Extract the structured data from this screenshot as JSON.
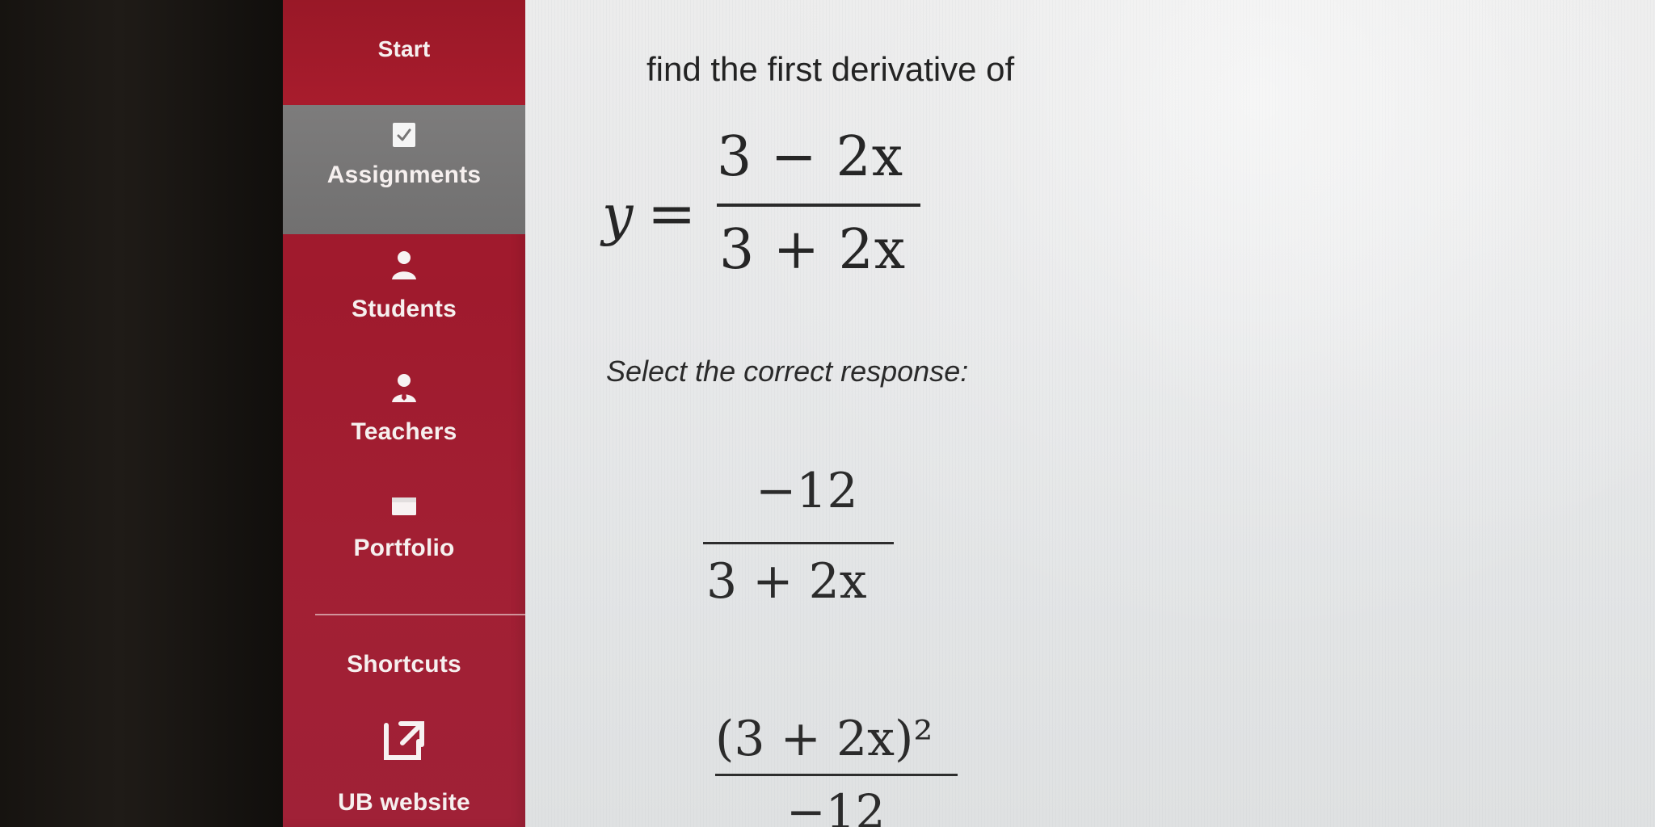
{
  "sidebar": {
    "start": "Start",
    "items": [
      {
        "label": "Assignments",
        "icon": "assignment-check-icon"
      },
      {
        "label": "Students",
        "icon": "student-icon"
      },
      {
        "label": "Teachers",
        "icon": "teacher-icon"
      },
      {
        "label": "Portfolio",
        "icon": "portfolio-icon"
      }
    ],
    "shortcuts_label": "Shortcuts",
    "website": {
      "label": "UB website",
      "icon": "external-link-icon"
    }
  },
  "question": {
    "prompt": "find the first derivative of",
    "equation_y": "y",
    "equation_equals": "=",
    "equation_numerator": "3 − 2x",
    "equation_denominator": "3 + 2x",
    "instruction": "Select the correct response:"
  },
  "responses": [
    {
      "numerator": "−12",
      "denominator": "3 + 2x"
    },
    {
      "numerator": "(3 + 2x)²",
      "denominator": "−12"
    }
  ],
  "colors": {
    "sidebar": "#a41c2f",
    "active_item": "#777676",
    "page_background": "#e8e9ea",
    "text": "#262626"
  }
}
